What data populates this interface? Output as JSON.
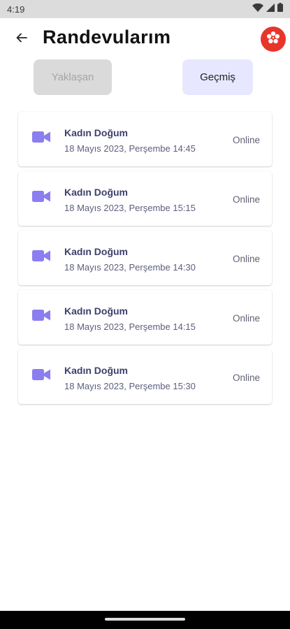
{
  "status_bar": {
    "time": "4:19",
    "icons": [
      "wifi-icon",
      "signal-icon",
      "battery-icon"
    ]
  },
  "header": {
    "back_icon": "arrow-left-icon",
    "title": "Randevularım",
    "logo_icon": "brand-logo-icon",
    "logo_color": "#e8352a"
  },
  "tabs": [
    {
      "label": "Yaklaşan",
      "active": false
    },
    {
      "label": "Geçmiş",
      "active": true
    }
  ],
  "appointments": [
    {
      "title": "Kadın Doğum",
      "date": "18 Mayıs 2023, Perşembe 14:45",
      "type": "Online",
      "icon": "video-camera-icon"
    },
    {
      "title": "Kadın Doğum",
      "date": "18 Mayıs 2023, Perşembe 15:15",
      "type": "Online",
      "icon": "video-camera-icon"
    },
    {
      "title": "Kadın Doğum",
      "date": "18 Mayıs 2023, Perşembe 14:30",
      "type": "Online",
      "icon": "video-camera-icon"
    },
    {
      "title": "Kadın Doğum",
      "date": "18 Mayıs 2023, Perşembe 14:15",
      "type": "Online",
      "icon": "video-camera-icon"
    },
    {
      "title": "Kadın Doğum",
      "date": "18 Mayıs 2023, Perşembe 15:30",
      "type": "Online",
      "icon": "video-camera-icon"
    }
  ],
  "colors": {
    "accent": "#8b7ef0",
    "active_tab_bg": "#e7e8ff",
    "inactive_tab_bg": "#dadada"
  }
}
